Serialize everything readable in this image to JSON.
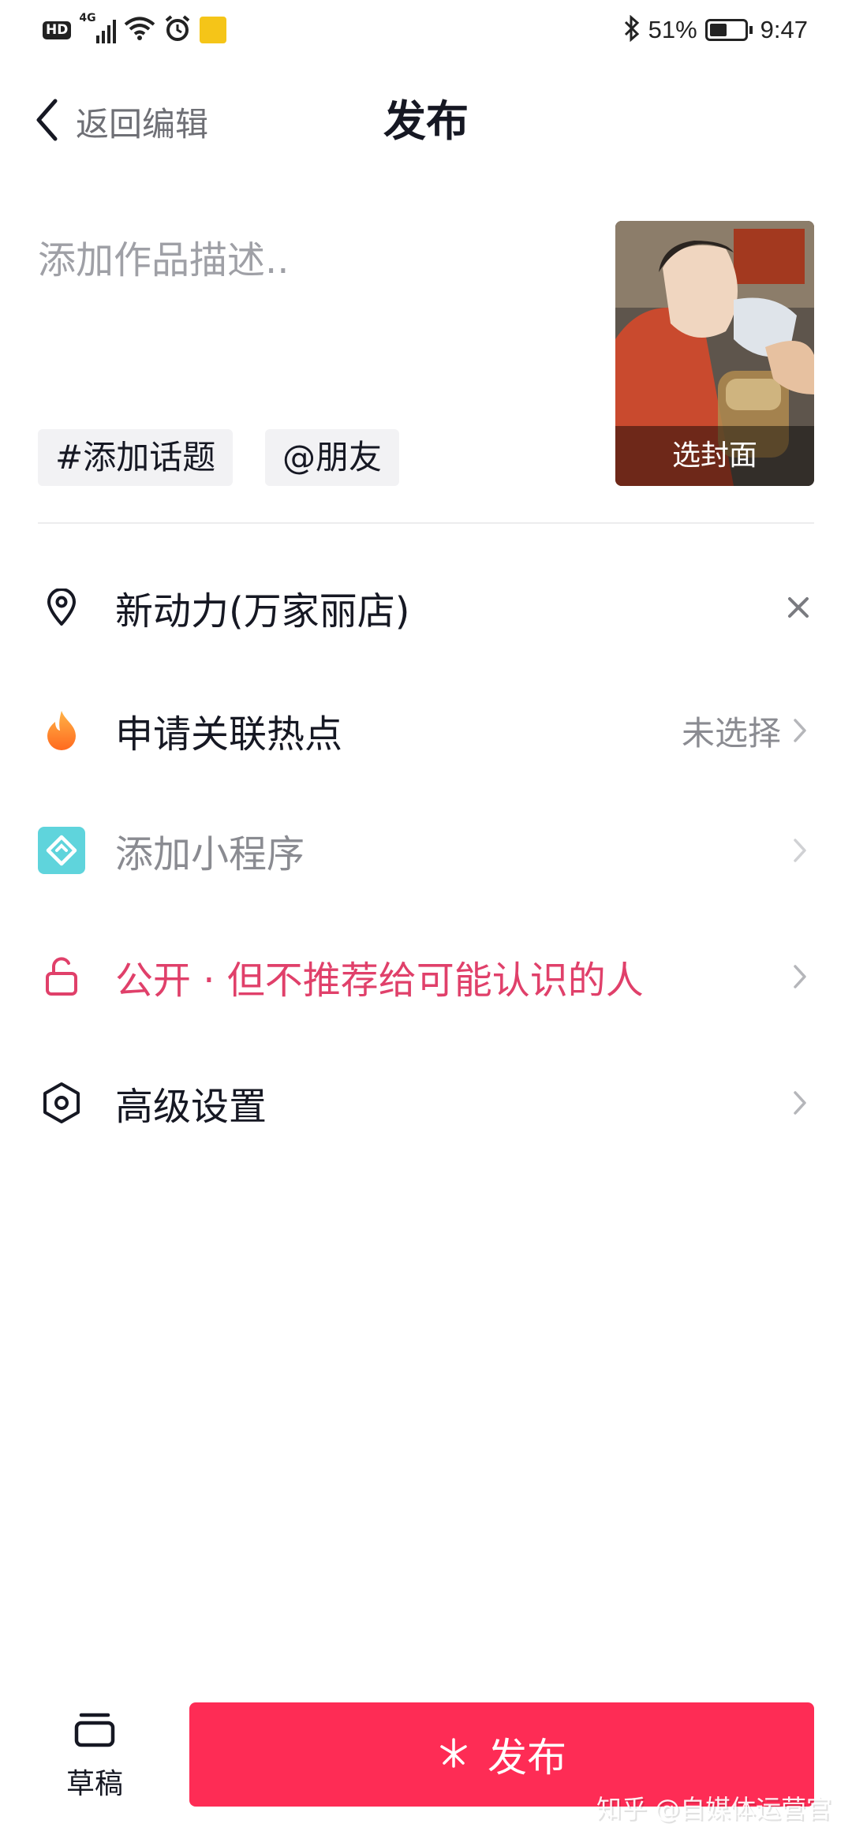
{
  "status_bar": {
    "network_badge": "HD",
    "network_type": "4G",
    "battery_percent": "51%",
    "time": "9:47",
    "battery_level": 0.51
  },
  "header": {
    "back_label": "返回编辑",
    "title": "发布"
  },
  "description": {
    "placeholder": "添加作品描述.."
  },
  "tags": {
    "topic": "#添加话题",
    "friend": "@朋友"
  },
  "cover": {
    "label": "选封面"
  },
  "rows": {
    "location": {
      "label": "新动力(万家丽店)",
      "icon": "location-pin-icon"
    },
    "hotspot": {
      "label": "申请关联热点",
      "value": "未选择",
      "icon": "flame-icon"
    },
    "mini_program": {
      "label": "添加小程序",
      "icon": "mini-program-icon"
    },
    "privacy": {
      "label": "公开 · 但不推荐给可能认识的人",
      "icon": "unlock-icon"
    },
    "advanced": {
      "label": "高级设置",
      "icon": "settings-hexagon-icon"
    }
  },
  "bottom": {
    "draft_label": "草稿",
    "publish_label": "发布"
  },
  "watermark": "知乎 @自媒体运营官",
  "colors": {
    "accent": "#fe2c55",
    "privacy_text": "#e0406a",
    "primary_text": "#161823",
    "secondary_text": "#8a8b91",
    "mini_program_icon": "#5fd4dc"
  }
}
